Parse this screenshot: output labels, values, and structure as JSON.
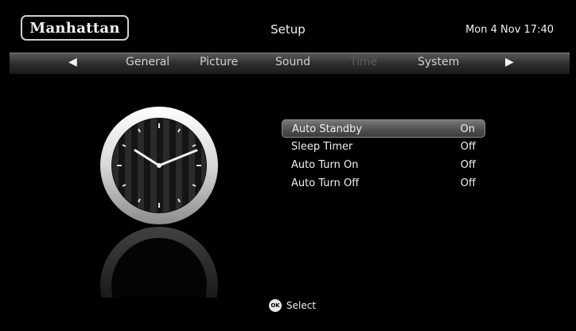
{
  "header": {
    "brand": "Manhattan",
    "title": "Setup",
    "datetime": "Mon 4 Nov 17:40"
  },
  "tabs": {
    "left_arrow": "◀",
    "right_arrow": "▶",
    "items": [
      {
        "label": "General",
        "active": false
      },
      {
        "label": "Picture",
        "active": false
      },
      {
        "label": "Sound",
        "active": false
      },
      {
        "label": "Time",
        "active": true
      },
      {
        "label": "System",
        "active": false
      }
    ]
  },
  "menu": {
    "items": [
      {
        "label": "Auto Standby",
        "value": "On",
        "selected": true
      },
      {
        "label": "Sleep Timer",
        "value": "Off",
        "selected": false
      },
      {
        "label": "Auto Turn On",
        "value": "Off",
        "selected": false
      },
      {
        "label": "Auto Turn Off",
        "value": "Off",
        "selected": false
      }
    ]
  },
  "footer": {
    "ok_icon": "ok-button-icon",
    "ok_label": "OK",
    "select_label": "Select"
  },
  "clock_icon": "analog-clock-icon"
}
